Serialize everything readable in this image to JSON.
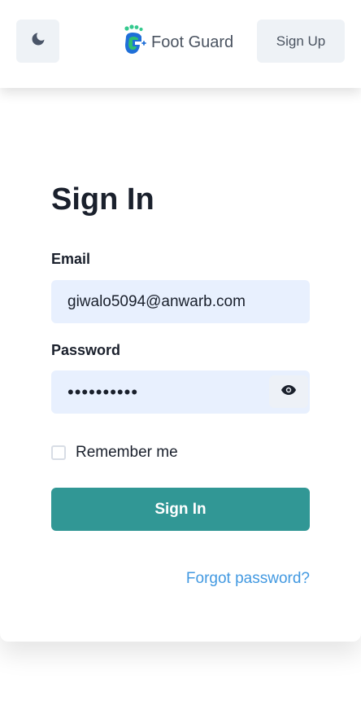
{
  "header": {
    "theme_toggle_icon": "moon-icon",
    "brand": {
      "logo_icon": "foot-guard-logo-icon",
      "name": "Foot Guard"
    },
    "signup_label": "Sign Up"
  },
  "form": {
    "title": "Sign In",
    "email": {
      "label": "Email",
      "value": "giwalo5094@anwarb.com"
    },
    "password": {
      "label": "Password",
      "value": "••••••••••",
      "toggle_icon": "eye-icon"
    },
    "remember": {
      "label": "Remember me",
      "checked": false
    },
    "submit_label": "Sign In",
    "forgot_label": "Forgot password?"
  },
  "colors": {
    "primary": "#319795",
    "link": "#4299e1",
    "input_bg": "#e8f0fe",
    "text": "#1a202c",
    "header_button_bg": "#eef2f6"
  }
}
